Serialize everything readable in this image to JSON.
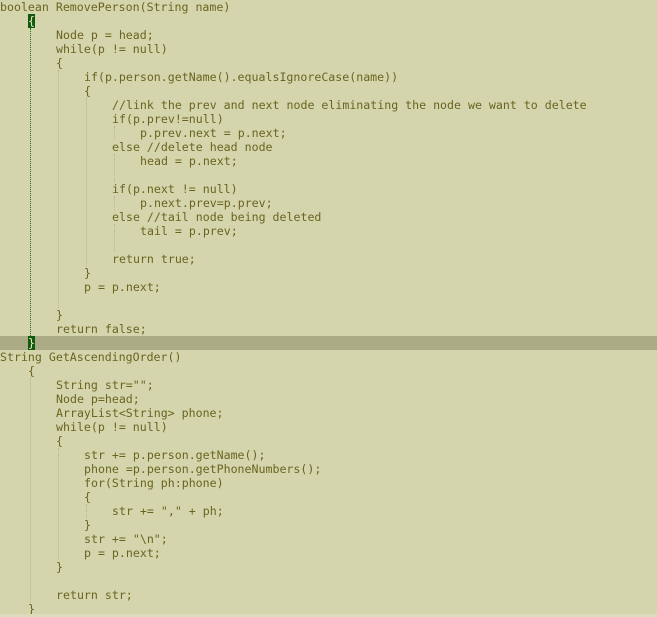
{
  "editor": {
    "current_line": 24,
    "colors": {
      "background": "#d5d5ad",
      "current_line": "#abab85",
      "text": "#6a6420",
      "brace_match": "#0f5a0f",
      "active_guide": "#1e6e1e",
      "guide": "#b5b59a"
    },
    "lines": [
      {
        "indent": 0,
        "text": "boolean RemovePerson(String name)"
      },
      {
        "indent": 1,
        "text": "{",
        "brace_match": true
      },
      {
        "indent": 2,
        "text": "Node p = head;"
      },
      {
        "indent": 2,
        "text": "while(p != null)"
      },
      {
        "indent": 2,
        "text": "{"
      },
      {
        "indent": 3,
        "text": "if(p.person.getName().equalsIgnoreCase(name))"
      },
      {
        "indent": 3,
        "text": "{"
      },
      {
        "indent": 4,
        "text": "//link the prev and next node eliminating the node we want to delete"
      },
      {
        "indent": 4,
        "text": "if(p.prev!=null)"
      },
      {
        "indent": 5,
        "text": "p.prev.next = p.next;"
      },
      {
        "indent": 4,
        "text": "else //delete head node"
      },
      {
        "indent": 5,
        "text": "head = p.next;"
      },
      {
        "indent": 0,
        "text": ""
      },
      {
        "indent": 4,
        "text": "if(p.next != null)"
      },
      {
        "indent": 5,
        "text": "p.next.prev=p.prev;"
      },
      {
        "indent": 4,
        "text": "else //tail node being deleted"
      },
      {
        "indent": 5,
        "text": "tail = p.prev;"
      },
      {
        "indent": 0,
        "text": ""
      },
      {
        "indent": 4,
        "text": "return true;"
      },
      {
        "indent": 3,
        "text": "}"
      },
      {
        "indent": 3,
        "text": "p = p.next;"
      },
      {
        "indent": 0,
        "text": ""
      },
      {
        "indent": 2,
        "text": "}"
      },
      {
        "indent": 2,
        "text": "return false;"
      },
      {
        "indent": 1,
        "text": "}",
        "brace_match": true
      },
      {
        "indent": 0,
        "text": "String GetAscendingOrder()"
      },
      {
        "indent": 1,
        "text": "{"
      },
      {
        "indent": 2,
        "text": "String str=\"\";"
      },
      {
        "indent": 2,
        "text": "Node p=head;"
      },
      {
        "indent": 2,
        "text": "ArrayList<String> phone;"
      },
      {
        "indent": 2,
        "text": "while(p != null)"
      },
      {
        "indent": 2,
        "text": "{"
      },
      {
        "indent": 3,
        "text": "str += p.person.getName();"
      },
      {
        "indent": 3,
        "text": "phone =p.person.getPhoneNumbers();"
      },
      {
        "indent": 3,
        "text": "for(String ph:phone)"
      },
      {
        "indent": 3,
        "text": "{"
      },
      {
        "indent": 4,
        "text": "str += \",\" + ph;"
      },
      {
        "indent": 3,
        "text": "}"
      },
      {
        "indent": 3,
        "text": "str += \"\\n\";"
      },
      {
        "indent": 3,
        "text": "p = p.next;"
      },
      {
        "indent": 2,
        "text": "}"
      },
      {
        "indent": 0,
        "text": ""
      },
      {
        "indent": 2,
        "text": "return str;"
      },
      {
        "indent": 1,
        "text": "}"
      }
    ]
  }
}
